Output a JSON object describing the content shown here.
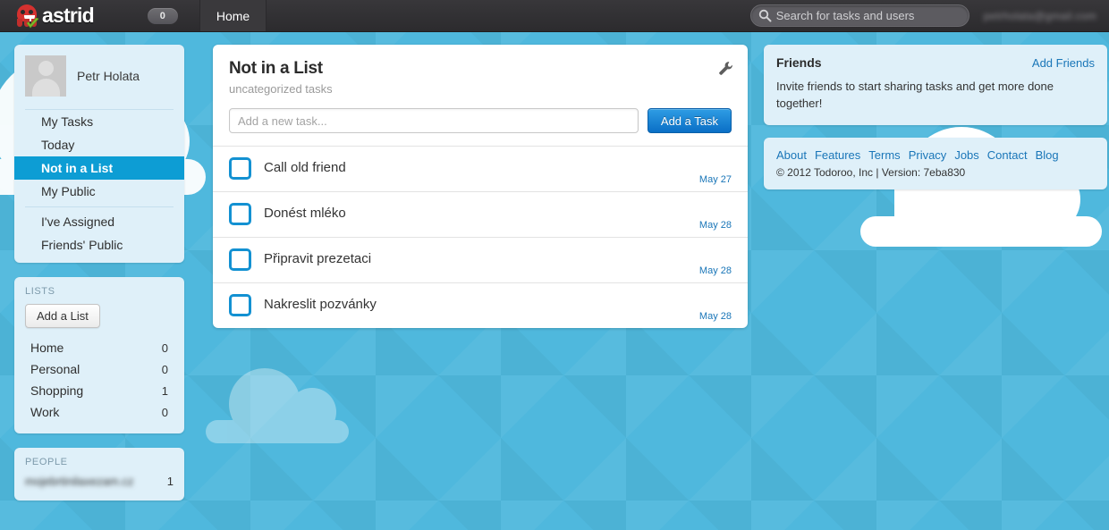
{
  "topnav": {
    "brand": "astrid",
    "brand_icon": "octopus-logo-icon",
    "badge_count": "0",
    "tab_home": "Home",
    "search_placeholder": "Search for tasks and users",
    "search_value": "",
    "search_icon": "search-icon",
    "user_email": "petrholata@gmail.com"
  },
  "sidebar": {
    "user_name": "Petr Holata",
    "avatar_icon": "avatar-placeholder-icon",
    "nav_items": [
      {
        "label": "My Tasks",
        "active": false,
        "separator": false
      },
      {
        "label": "Today",
        "active": false,
        "separator": false
      },
      {
        "label": "Not in a List",
        "active": true,
        "separator": false
      },
      {
        "label": "My Public",
        "active": false,
        "separator": false
      },
      {
        "label": "I've Assigned",
        "active": false,
        "separator": true
      },
      {
        "label": "Friends' Public",
        "active": false,
        "separator": false
      }
    ],
    "lists_label": "LISTS",
    "add_list_label": "Add a List",
    "lists": [
      {
        "name": "Home",
        "count": "0"
      },
      {
        "name": "Personal",
        "count": "0"
      },
      {
        "name": "Shopping",
        "count": "1"
      },
      {
        "name": "Work",
        "count": "0"
      }
    ],
    "people_label": "PEOPLE",
    "people": [
      {
        "name": "mojebrtinilaxezam.cz",
        "count": "1"
      }
    ]
  },
  "main": {
    "list_title": "Not in a List",
    "list_subtitle": "uncategorized tasks",
    "settings_icon": "wrench-icon",
    "new_task_placeholder": "Add a new task...",
    "new_task_value": "",
    "add_task_label": "Add a Task",
    "tasks": [
      {
        "title": "Call old friend",
        "date": "May 27",
        "done": false
      },
      {
        "title": "Donést mléko",
        "date": "May 28",
        "done": false
      },
      {
        "title": "Připravit prezetaci",
        "date": "May 28",
        "done": false
      },
      {
        "title": "Nakreslit pozvánky",
        "date": "May 28",
        "done": false
      }
    ]
  },
  "right": {
    "friends_title": "Friends",
    "add_friends_label": "Add Friends",
    "friends_body": "Invite friends to start sharing tasks and get more done together!",
    "footer_links": [
      "About",
      "Features",
      "Terms",
      "Privacy",
      "Jobs",
      "Contact",
      "Blog"
    ],
    "copyright": "© 2012 Todoroo, Inc | Version: 7eba830"
  },
  "colors": {
    "sky": "#4fb8dd",
    "panel": "#dff0f9",
    "accent_blue": "#0d9dd4",
    "link_blue": "#1a76b8",
    "checkbox_blue": "#1391d2",
    "nav_dark": "#2c2b2e",
    "logo_red": "#d5312f",
    "check_green": "#7cbb2c"
  }
}
